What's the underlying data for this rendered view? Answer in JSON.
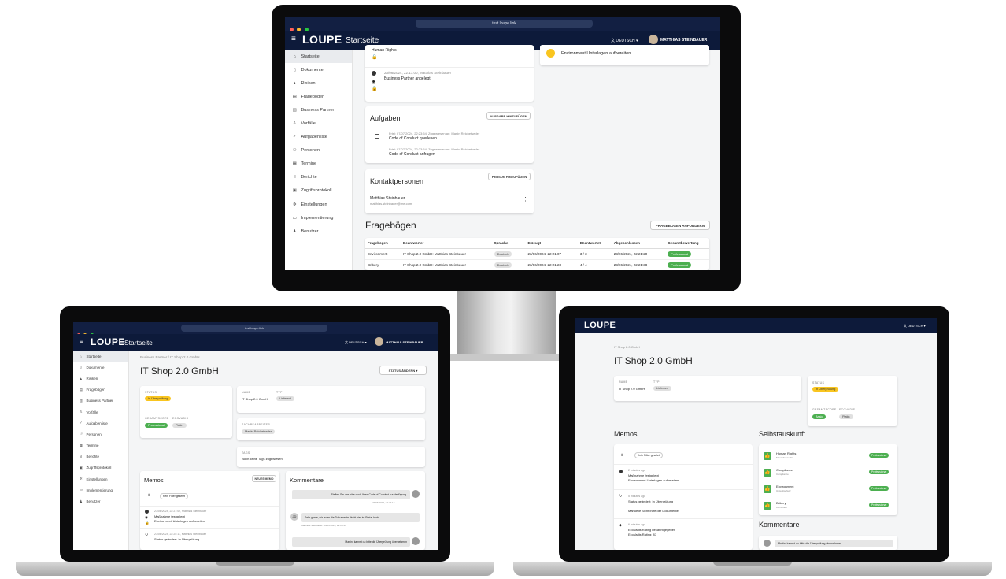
{
  "browser": {
    "url": "test.loupe.link"
  },
  "app": {
    "logo": "LOUPE",
    "page_title": "Startseite",
    "language": "DEUTSCH",
    "user": "MATTHIAS STEINBAUER"
  },
  "sidebar": {
    "items": [
      {
        "label": "Startseite",
        "icon": "home-icon"
      },
      {
        "label": "Dokumente",
        "icon": "document-icon"
      },
      {
        "label": "Risiken",
        "icon": "warning-icon"
      },
      {
        "label": "Fragebögen",
        "icon": "form-icon"
      },
      {
        "label": "Business Partner",
        "icon": "business-icon"
      },
      {
        "label": "Vorfälle",
        "icon": "incident-icon"
      },
      {
        "label": "Aufgabenliste",
        "icon": "check-icon"
      },
      {
        "label": "Personen",
        "icon": "people-icon"
      },
      {
        "label": "Termine",
        "icon": "calendar-icon"
      },
      {
        "label": "Berichte",
        "icon": "chart-icon"
      },
      {
        "label": "Zugriffsprotokoll",
        "icon": "protocol-icon"
      },
      {
        "label": "Einstellungen",
        "icon": "gear-icon"
      },
      {
        "label": "Implementierung",
        "icon": "implementation-icon"
      },
      {
        "label": "Benutzer",
        "icon": "user-icon"
      }
    ]
  },
  "desktop": {
    "history": [
      {
        "text": "Human Rights"
      },
      {
        "meta": "23/06/2024, 22:17:00, Matthias Steinbauer",
        "text": "Business Partner angelegt"
      }
    ],
    "right_task": "Environment Unterlagen aufbereiten",
    "tasks": {
      "title": "Aufgaben",
      "add_button": "AUFGABE HINZUFÜGEN",
      "items": [
        {
          "meta": "Frist: 07/07/2024, 22:23:54, Zugewiesen an: Martin Reichetseder",
          "text": "Code of Conduct querlesen"
        },
        {
          "meta": "Frist: 07/07/2024, 22:23:54, Zugewiesen an: Martin Reichetseder",
          "text": "Code of Conduct anfragen"
        }
      ]
    },
    "contacts": {
      "title": "Kontaktpersonen",
      "add_button": "PERSON HINZUFÜGEN",
      "name": "Matthias Steinbauer",
      "email": "matthias.steinbauer@me.com"
    },
    "questionnaires": {
      "title": "Fragebögen",
      "request_button": "FRAGEBOGEN ANFORDERN",
      "columns": [
        "Fragebogen",
        "Beantworter",
        "Sprache",
        "Erzeugt",
        "Beantwortet",
        "Abgeschlossen",
        "Gesamtbewertung"
      ],
      "rows": [
        [
          "Environment",
          "IT Shop 2.0 GmbH: Matthias Steinbauer",
          "Deutsch",
          "23/06/2024, 22:21:07",
          "3 / 3",
          "23/06/2024, 22:21:20",
          "Professional"
        ],
        [
          "Bribery",
          "IT Shop 2.0 GmbH: Matthias Steinbauer",
          "Deutsch",
          "23/06/2024, 22:21:23",
          "4 / 4",
          "23/06/2024, 22:21:38",
          "Professional"
        ]
      ]
    }
  },
  "laptop_left": {
    "breadcrumb": "Business Partner / IT Shop 2.0 GmbH",
    "title": "IT Shop 2.0 GmbH",
    "status_button": "STATUS ÄNDERN",
    "status_label": "STATUS",
    "status_value": "In Überprüfung",
    "bewertung_label": "GESAMTSCORE",
    "bewertung_value": "Professional",
    "ecovadis_label": "ECOVADIS",
    "ecovadis_value": "Platin",
    "name_label": "NAME",
    "name_value": "IT Shop 2.0 GmbH",
    "typ_label": "TYP",
    "typ_value": "Lieferant",
    "sach_label": "SACHBEARBEITER",
    "sach_value": "Martin Reichetseder",
    "tags_label": "TAGS",
    "tags_value": "Noch keine Tags zugewiesen",
    "memos": {
      "title": "Memos",
      "new_button": "NEUES MEMO",
      "filter": "Kein Filter gesetzt",
      "items": [
        {
          "meta": "23/06/2024, 22:27:02, Matthias Steinbauer",
          "text1": "Maßnahme festgelegt",
          "text2": "Environment Unterlagen aufbereiten"
        },
        {
          "meta": "23/06/2024, 22:24:11, Matthias Steinbauer",
          "text1": "Status geändert: In Überprüfung",
          "text2": ""
        }
      ]
    },
    "comments": {
      "title": "Kommentare",
      "items": [
        {
          "text": "Stellen Sie uns bitte noch Ihren Code of Conduct zur Verfügung.",
          "meta": "23/06/2024, 22:23:17",
          "side": "right"
        },
        {
          "text": "Sehr gerne, wir laden die Dokumente direkt hier im Portal hoch.",
          "meta": "Matthias Steinbauer: 23/06/2024, 22:25:47",
          "side": "left",
          "initials": "JD"
        },
        {
          "text": "Martin, kannst du bitte die Überprüfung übernehmen",
          "meta": "",
          "side": "right"
        }
      ]
    }
  },
  "laptop_right": {
    "breadcrumb": "IT Shop 2.0 GmbH",
    "title": "IT Shop 2.0 GmbH",
    "name_label": "NAME",
    "name_value": "IT Shop 2.0 GmbH",
    "typ_label": "TYP",
    "typ_value": "Lieferant",
    "status_label": "STATUS",
    "status_value": "In Überprüfung",
    "score_label": "GESAMTSCORE",
    "score_value": "Basic",
    "ecovadis_label": "ECOVADIS",
    "ecovadis_value": "Platin",
    "memos": {
      "title": "Memos",
      "filter": "Kein Filter gesetzt",
      "items": [
        {
          "meta": "2 minutes ago",
          "text1": "Maßnahme festgelegt",
          "text2": "Environment Unterlagen aufbereiten"
        },
        {
          "meta": "5 minutes ago",
          "text1": "Status geändert: In Überprüfung",
          "text2": "Manuelle Sichtprüfe der Dokumente"
        },
        {
          "meta": "6 minutes ago",
          "text1": "EcoVadis Rating bekanntgegeben",
          "text2": "EcoVadis Rating: 87"
        }
      ]
    },
    "self_disclosure": {
      "title": "Selbstauskunft",
      "items": [
        {
          "name": "Human Rights",
          "sub": "Menschenrechte",
          "rating": "Professional"
        },
        {
          "name": "Compliance",
          "sub": "Compliance",
          "rating": "Professional"
        },
        {
          "name": "Environment",
          "sub": "Umweltschutz",
          "rating": "Professional"
        },
        {
          "name": "Bribery",
          "sub": "Korruption",
          "rating": "Professional"
        }
      ]
    },
    "comments": {
      "title": "Kommentare",
      "first": "Martin, kannst du bitte die Überprüfung übernehmen"
    }
  },
  "colors": {
    "navy": "#0d1a3a",
    "green": "#4caf50",
    "yellow": "#f9c51f"
  }
}
